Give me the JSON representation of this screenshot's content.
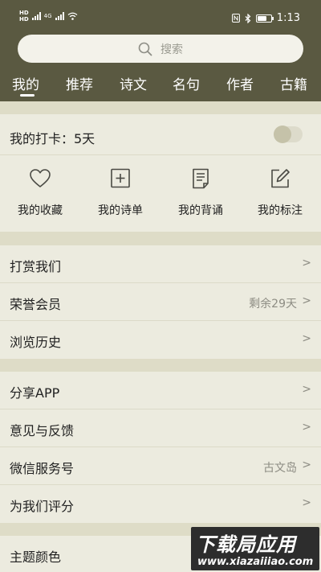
{
  "status_bar": {
    "network": "4G",
    "time": "1:13",
    "battery_level": 0.7
  },
  "search": {
    "placeholder": "搜索"
  },
  "tabs": [
    {
      "label": "我的",
      "active": true
    },
    {
      "label": "推荐",
      "active": false
    },
    {
      "label": "诗文",
      "active": false
    },
    {
      "label": "名句",
      "active": false
    },
    {
      "label": "作者",
      "active": false
    },
    {
      "label": "古籍",
      "active": false
    }
  ],
  "checkin": {
    "label": "我的打卡：5天",
    "enabled": false
  },
  "shortcuts": [
    {
      "label": "我的收藏",
      "icon": "heart-icon"
    },
    {
      "label": "我的诗单",
      "icon": "plus-square-icon"
    },
    {
      "label": "我的背诵",
      "icon": "document-icon"
    },
    {
      "label": "我的标注",
      "icon": "edit-icon"
    }
  ],
  "group1": [
    {
      "label": "打赏我们",
      "value": "",
      "arrow": ">"
    },
    {
      "label": "荣誉会员",
      "value": "剩余29天",
      "arrow": ">"
    },
    {
      "label": "浏览历史",
      "value": "",
      "arrow": ">"
    }
  ],
  "group2": [
    {
      "label": "分享APP",
      "value": "",
      "arrow": ">"
    },
    {
      "label": "意见与反馈",
      "value": "",
      "arrow": ">"
    },
    {
      "label": "微信服务号",
      "value": "古文岛",
      "arrow": ">"
    },
    {
      "label": "为我们评分",
      "value": "",
      "arrow": ">"
    }
  ],
  "group3": [
    {
      "label": "主题颜色",
      "value": "",
      "arrow": ""
    }
  ],
  "watermark": {
    "main": "下载局应用",
    "sub": "www.xiazaiiiao.com"
  },
  "colors": {
    "header_bg": "#5a5941",
    "page_bg": "#e4e2cf",
    "section_bg": "#ecebdf",
    "muted_text": "#8d8c83"
  }
}
